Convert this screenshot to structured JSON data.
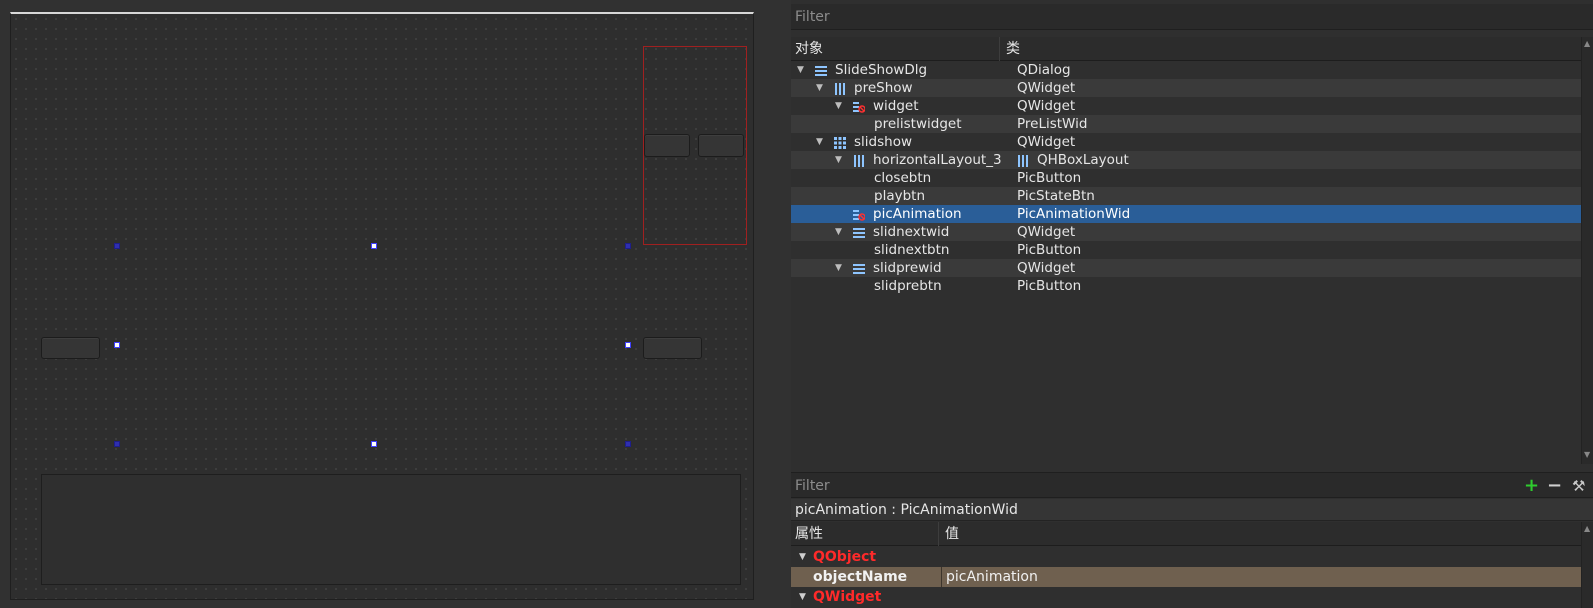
{
  "object_inspector": {
    "filter_placeholder": "Filter",
    "columns": {
      "object": "对象",
      "class": "类"
    },
    "rows": [
      {
        "object": "SlideShowDlg",
        "class": "QDialog",
        "depth": 0,
        "expanded": true,
        "icon": "vbox-layout-icon"
      },
      {
        "object": "preShow",
        "class": "QWidget",
        "depth": 1,
        "expanded": true,
        "icon": "hbox-layout-icon"
      },
      {
        "object": "widget",
        "class": "QWidget",
        "depth": 2,
        "expanded": true,
        "icon": "broken-layout-icon"
      },
      {
        "object": "prelistwidget",
        "class": "PreListWid",
        "depth": 3,
        "expanded": null,
        "icon": ""
      },
      {
        "object": "slidshow",
        "class": "QWidget",
        "depth": 1,
        "expanded": true,
        "icon": "grid-layout-icon"
      },
      {
        "object": "horizontalLayout_3",
        "class": "QHBoxLayout",
        "depth": 2,
        "expanded": true,
        "icon": "hbox-layout-icon",
        "class_icon": "hbox-layout-icon"
      },
      {
        "object": "closebtn",
        "class": "PicButton",
        "depth": 3,
        "expanded": null,
        "icon": ""
      },
      {
        "object": "playbtn",
        "class": "PicStateBtn",
        "depth": 3,
        "expanded": null,
        "icon": ""
      },
      {
        "object": "picAnimation",
        "class": "PicAnimationWid",
        "depth": 2,
        "expanded": null,
        "icon": "broken-layout-icon",
        "selected": true
      },
      {
        "object": "slidnextwid",
        "class": "QWidget",
        "depth": 2,
        "expanded": true,
        "icon": "vbox-layout-icon"
      },
      {
        "object": "slidnextbtn",
        "class": "PicButton",
        "depth": 3,
        "expanded": null,
        "icon": ""
      },
      {
        "object": "slidprewid",
        "class": "QWidget",
        "depth": 2,
        "expanded": true,
        "icon": "vbox-layout-icon"
      },
      {
        "object": "slidprebtn",
        "class": "PicButton",
        "depth": 3,
        "expanded": null,
        "icon": ""
      }
    ]
  },
  "property_editor": {
    "filter_placeholder": "Filter",
    "toolbar": {
      "add_icon": "plus-icon",
      "remove_icon": "minus-icon",
      "configure_icon": "wrench-icon"
    },
    "object_label": "picAnimation : PicAnimationWid",
    "columns": {
      "property": "属性",
      "value": "值"
    },
    "sections": [
      {
        "name": "QObject",
        "rows": [
          {
            "key": "objectName",
            "value": "picAnimation"
          }
        ]
      },
      {
        "name": "QWidget",
        "rows": []
      }
    ]
  },
  "colors": {
    "selection": "#2a5e98",
    "category": "#ff2a2a",
    "edited_property": "#6f604f",
    "layout_frame": "#a02020"
  }
}
